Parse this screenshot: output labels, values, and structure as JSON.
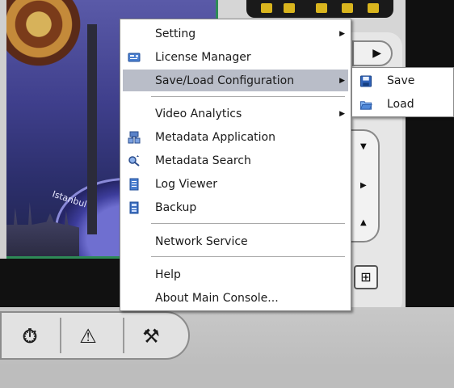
{
  "menu": {
    "items": [
      {
        "label": "Setting",
        "icon": "settings-icon",
        "submenu": true
      },
      {
        "label": "License Manager",
        "icon": "license-card-icon"
      },
      {
        "label": "Save/Load Configuration",
        "submenu": true,
        "highlighted": true
      },
      {
        "label": "Video Analytics",
        "submenu": true
      },
      {
        "label": "Metadata Application",
        "icon": "metadata-application-icon"
      },
      {
        "label": "Metadata Search",
        "icon": "metadata-search-icon"
      },
      {
        "label": "Log Viewer",
        "icon": "log-viewer-icon"
      },
      {
        "label": "Backup",
        "icon": "backup-icon"
      },
      {
        "label": "Network Service"
      },
      {
        "label": "Help"
      },
      {
        "label": "About Main Console..."
      }
    ],
    "submenu_arrow": "▶"
  },
  "submenu": {
    "items": [
      {
        "label": "Save",
        "icon": "floppy-disk-icon"
      },
      {
        "label": "Load",
        "icon": "open-folder-icon"
      }
    ]
  },
  "background": {
    "video_overlay_text": "Istanbul",
    "play_symbol": "▶",
    "nav_up": "▼",
    "nav_right": "▶",
    "nav_down": "▲",
    "zoom_symbol": "⊞",
    "bottom_buttons": [
      {
        "icon": "schedule-clock-icon",
        "symbol": "⏱"
      },
      {
        "icon": "warning-icon",
        "symbol": "⚠"
      },
      {
        "icon": "tools-hammer-icon",
        "symbol": "⚒"
      }
    ]
  },
  "colors": {
    "highlight": "#b9bdc8",
    "menu_bg": "#ffffff",
    "menu_border": "#8a8a8a",
    "video_border": "#2e8b57",
    "toolbar_icon": "#d9b51e"
  }
}
